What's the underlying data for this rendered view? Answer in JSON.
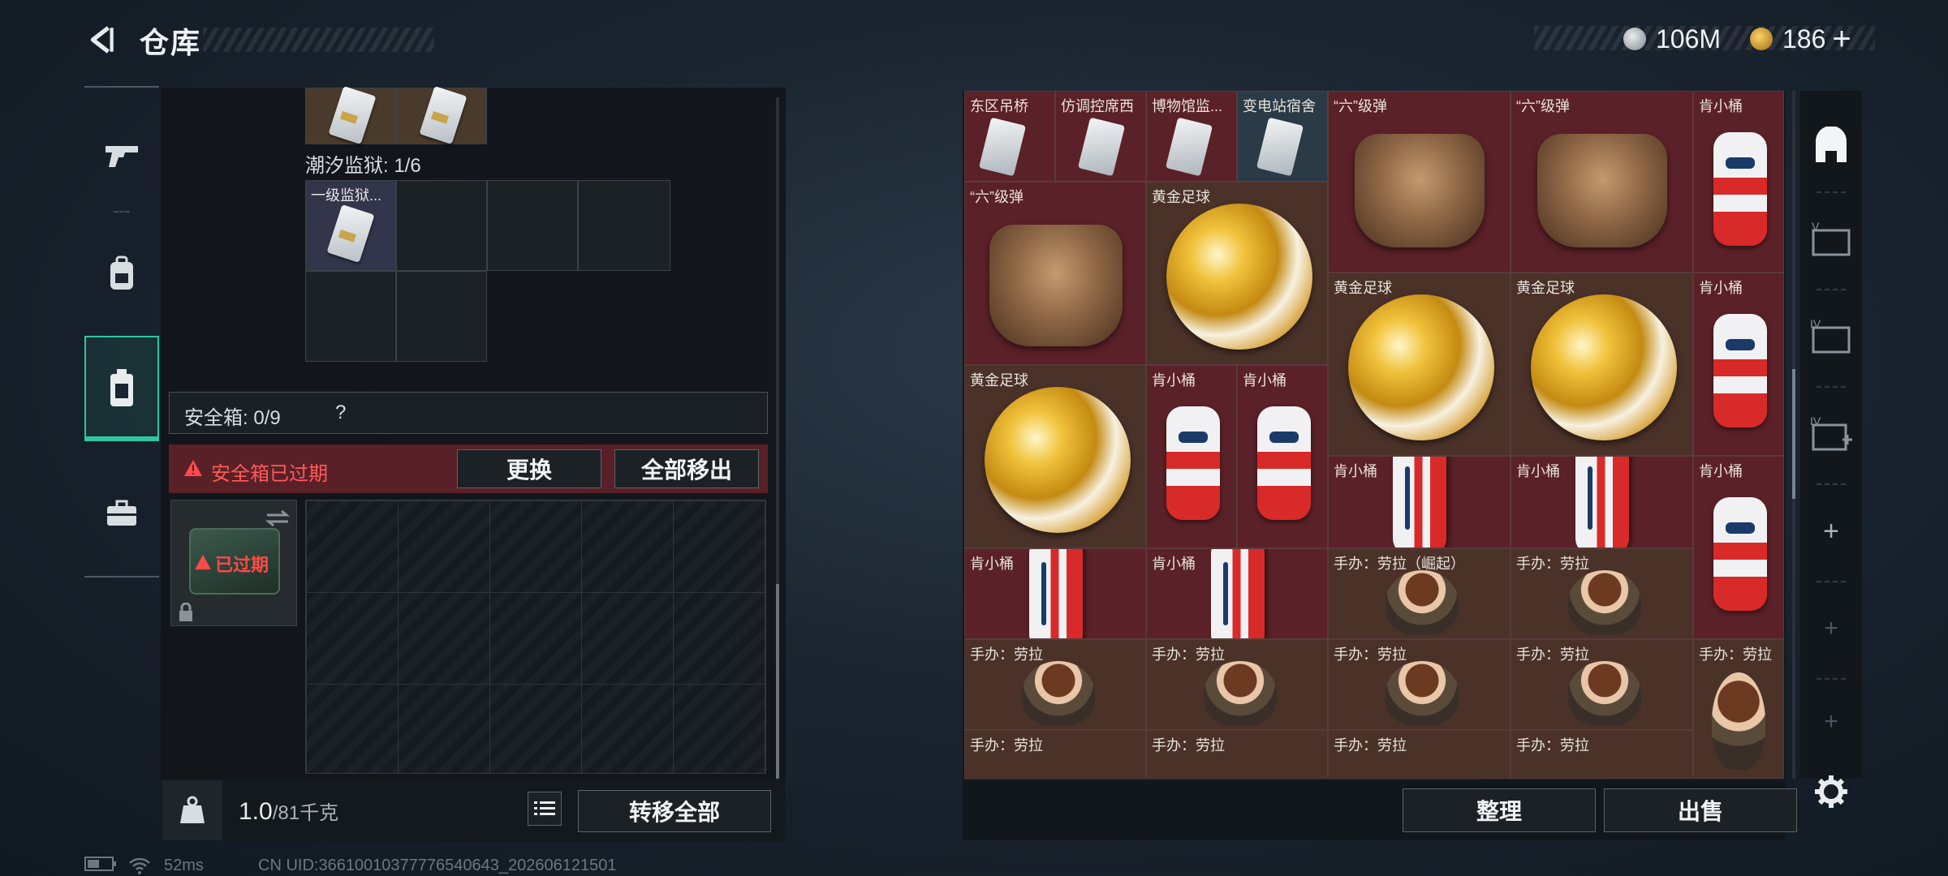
{
  "header": {
    "title": "仓库"
  },
  "currency": [
    {
      "icon": "silver-coin-icon",
      "amount": "106M"
    },
    {
      "icon": "gold-coin-icon",
      "amount": "186",
      "plus": "+"
    }
  ],
  "left_nav": [
    "gun-icon",
    "backpack-icon",
    "safebox-icon",
    "briefcase-icon"
  ],
  "container": {
    "prison_label": "潮汐监狱: 1/6",
    "prison_item": "一级监狱..."
  },
  "safebox": {
    "label": "安全箱: 0/9",
    "help": "?",
    "expired_notice": "安全箱已过期",
    "replace_button": "更换",
    "remove_all_button": "全部移出",
    "item_status": "已过期"
  },
  "weight": {
    "current": "1.0",
    "max": "/81千克"
  },
  "transfer_all_button": "转移全部",
  "stash": {
    "top_row_labels": [
      "东区吊桥",
      "仿调控席西",
      "博物馆监...",
      "变电站宿舍"
    ],
    "items": {
      "hand": "“六”级弹",
      "ball": "黄金足球",
      "bucket": "肯小桶",
      "figure": "手办：劳拉",
      "figure_raised": "手办：劳拉（崛起）"
    }
  },
  "right_sidebar": [
    "backpack-icon",
    "card-folder-icon",
    "card-folder-iv-icon",
    "card-add-iv-icon",
    "plus-icon",
    "plus-icon",
    "plus-icon"
  ],
  "sort_button": "整理",
  "sell_button": "出售",
  "status": {
    "ping": "52ms",
    "uid": "CN UID:36610010377776540643_202606121501"
  }
}
